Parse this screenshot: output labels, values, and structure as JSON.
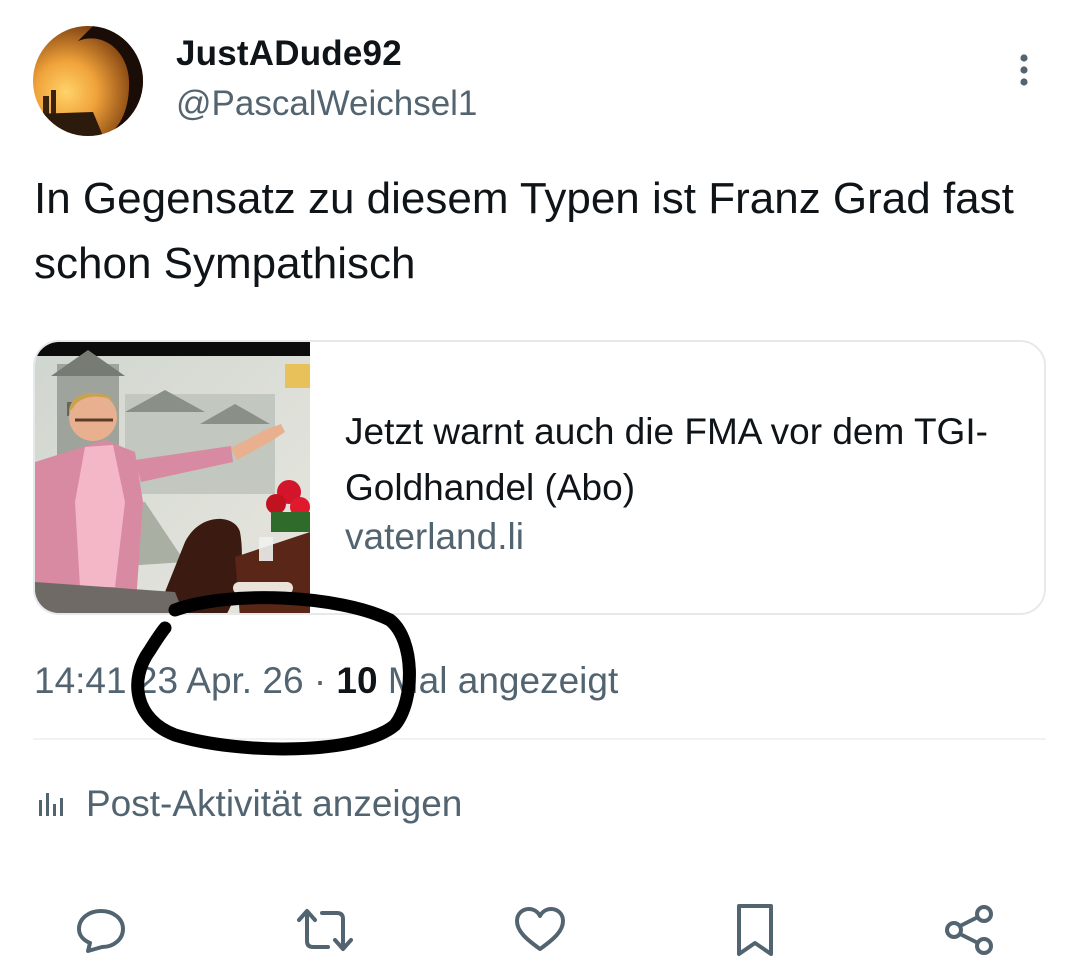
{
  "author": {
    "display_name": "JustADude92",
    "handle": "@PascalWeichsel1"
  },
  "tweet": {
    "text": "In Gegensatz zu diesem Typen ist Franz Grad fast schon Sympathisch"
  },
  "link_card": {
    "title": "Jetzt warnt auch die FMA vor dem TGI-Goldhandel (Abo)",
    "domain": "vaterland.li"
  },
  "meta": {
    "time": "14:41",
    "separator": "·",
    "date": "23 Apr. 26",
    "views_count": "10",
    "views_label": "Mal angezeigt"
  },
  "activity": {
    "label": "Post-Aktivität anzeigen"
  },
  "actions": {
    "icons": [
      "reply-icon",
      "repost-icon",
      "like-icon",
      "bookmark-icon",
      "share-icon"
    ]
  },
  "colors": {
    "text_primary": "#0f1419",
    "text_secondary": "#536471",
    "border": "#e6e9ec",
    "annotation_ink": "#000000"
  }
}
